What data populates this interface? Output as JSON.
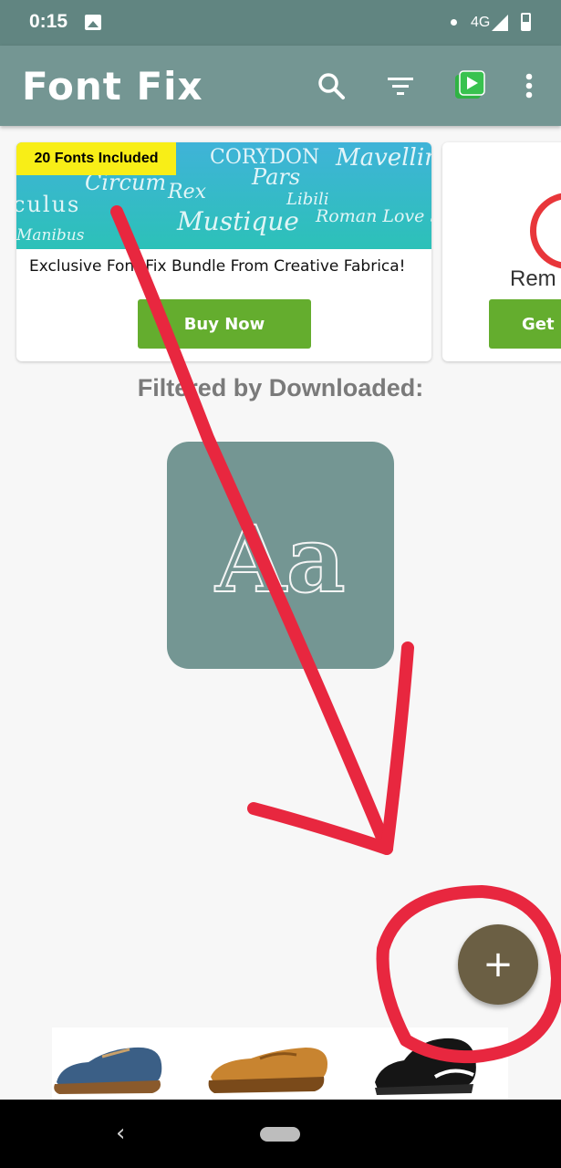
{
  "status_bar": {
    "time": "0:15",
    "network": "4G",
    "image_icon": "image-icon",
    "signal_icon": "signal-icon",
    "battery_icon": "battery-icon"
  },
  "app_bar": {
    "title": "Font Fix",
    "icons": [
      "search-icon",
      "filter-icon",
      "play-store-icon",
      "more-vert-icon"
    ],
    "color": "#749693"
  },
  "promo_card": {
    "badge": "20 Fonts Included",
    "banner_words": [
      "Circum",
      "Rex",
      "CORYDON",
      "Pars",
      "Mustique",
      "Libili",
      "Roman Love St",
      "Manibus",
      "culus",
      "Mavellime"
    ],
    "title": "Exclusive Font Fix Bundle From Creative Fabrica!",
    "button": "Buy Now"
  },
  "promo_card_2": {
    "partial_text": "Rem",
    "button": "Get"
  },
  "filter_label": "Filtered by Downloaded:",
  "font_tile": {
    "preview_text": "Aa"
  },
  "fab": {
    "icon": "plus-icon",
    "label": "+",
    "color": "#6b5f44"
  },
  "ad_strip": {
    "items": [
      "blue-suede-shoe",
      "tan-loafer",
      "black-sneaker"
    ]
  },
  "nav_bar": {
    "back_glyph": "‹",
    "back_icon": "back-icon",
    "home_icon": "home-pill"
  },
  "annotation": {
    "color": "#e8273f",
    "shapes": [
      "arrow-down",
      "circle-around-fab"
    ]
  }
}
